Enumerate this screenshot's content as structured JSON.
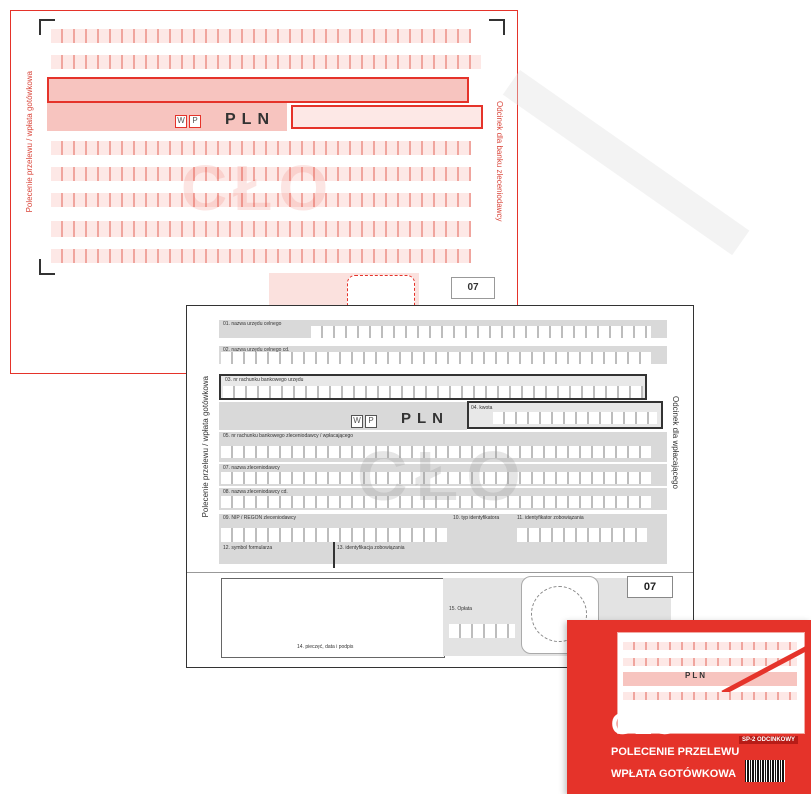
{
  "red_form": {
    "currency": "PLN",
    "wp": [
      "W",
      "P"
    ],
    "code": "07",
    "side_left": "Polecenie przelewu / wpłata gotówkowa",
    "side_right": "Odcinek dla banku zleceniodawcy",
    "watermark": "CŁO"
  },
  "bw_form": {
    "currency": "PLN",
    "wp": [
      "W",
      "P"
    ],
    "code": "07",
    "side_left": "Polecenie przelewu / wpłata gotówkowa",
    "side_right": "Odcinek dla wpłacającego",
    "watermark": "CŁO",
    "rows": [
      "01. nazwa urzędu celnego",
      "02. nazwa urzędu celnego cd.",
      "03. nr rachunku bankowego urzędu",
      "04. kwota",
      "05. nr rachunku bankowego zleceniodawcy / wpłacającego",
      "07. nazwa zleceniodawcy",
      "08. nazwa zleceniodawcy cd.",
      "09. NIP / REGON zleceniodawcy",
      "10. typ identyfikatora",
      "11. identyfikator zobowiązania",
      "12. symbol formularza",
      "13. identyfikacja zobowiązania",
      "14. pieczęć, data i podpis",
      "15. Opłata"
    ]
  },
  "cover": {
    "title": "CŁO",
    "subtitle1": "POLECENIE PRZELEWU",
    "subtitle2": "WPŁATA GOTÓWKOWA",
    "badge": "SP-2 ODCINKOWY",
    "currency": "PLN"
  },
  "colors": {
    "red": "#e5332a",
    "pink": "#f7c4bf",
    "gray": "#d9d9d9"
  }
}
